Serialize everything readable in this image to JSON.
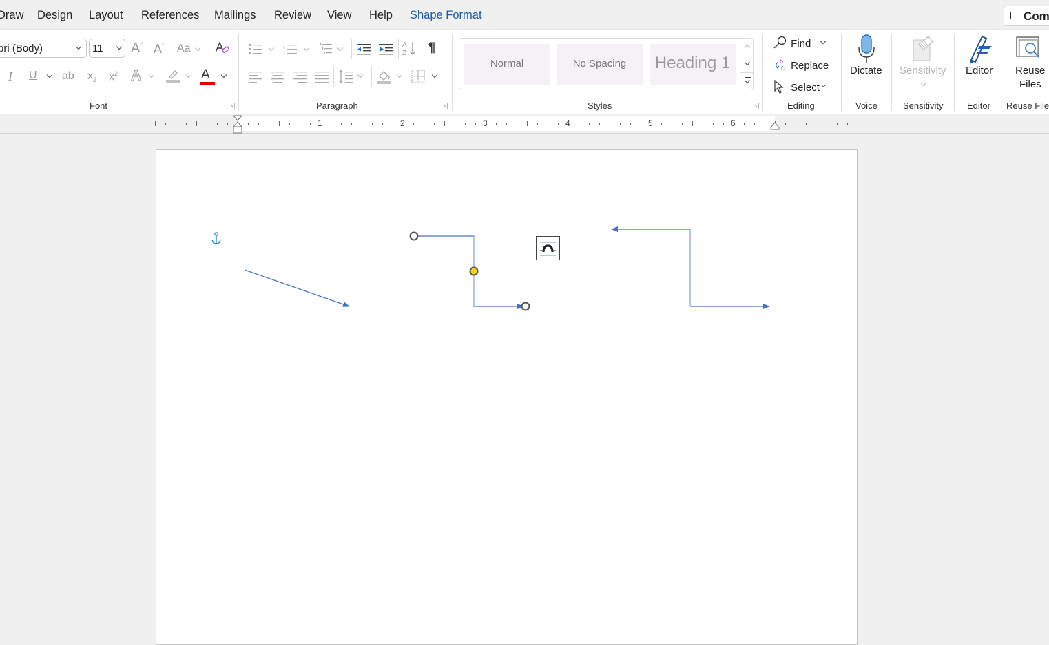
{
  "tabs": [
    {
      "label": "Draw",
      "active": false
    },
    {
      "label": "Design",
      "active": false
    },
    {
      "label": "Layout",
      "active": false
    },
    {
      "label": "References",
      "active": false
    },
    {
      "label": "Mailings",
      "active": false
    },
    {
      "label": "Review",
      "active": false
    },
    {
      "label": "View",
      "active": false
    },
    {
      "label": "Help",
      "active": false
    },
    {
      "label": "Shape Format",
      "active": true
    }
  ],
  "comments_label": "Com",
  "font_group": {
    "label": "Font",
    "font_name": "bri (Body)",
    "font_size": "11",
    "grow_font": "A",
    "shrink_font": "A",
    "change_case": "Aa",
    "italic": "I",
    "underline": "U",
    "strikethrough": "ab",
    "subscript": "x",
    "superscript": "x",
    "text_effects": "A",
    "font_color": "A",
    "font_color_hex": "#e00000"
  },
  "paragraph_group": {
    "label": "Paragraph",
    "show_marks": "¶"
  },
  "styles_group": {
    "label": "Styles",
    "items": [
      {
        "label": "Normal"
      },
      {
        "label": "No Spacing"
      },
      {
        "label": "Heading 1"
      }
    ]
  },
  "editing_group": {
    "label": "Editing",
    "find": "Find",
    "replace": "Replace",
    "select": "Select"
  },
  "voice_group": {
    "label": "Voice",
    "dictate": "Dictate"
  },
  "sensitivity_group": {
    "label": "Sensitivity",
    "button": "Sensitivity"
  },
  "editor_group": {
    "label": "Editor",
    "button": "Editor"
  },
  "reuse_group": {
    "label": "Reuse Files",
    "button_line1": "Reuse",
    "button_line2": "Files"
  },
  "ruler": {
    "numbers": [
      "1",
      "2",
      "3",
      "4",
      "5",
      "6"
    ]
  },
  "document": {
    "shapes": [
      {
        "type": "straight-arrow",
        "selected": false
      },
      {
        "type": "elbow-connector-arrow",
        "selected": true
      },
      {
        "type": "elbow-double-arrow",
        "selected": false
      }
    ],
    "line_color": "#4472c4"
  }
}
